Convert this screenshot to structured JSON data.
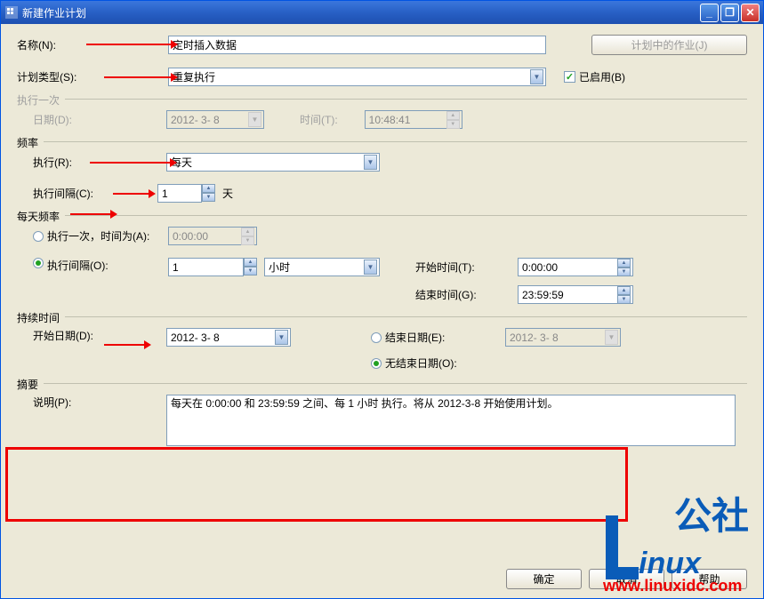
{
  "window": {
    "title": "新建作业计划"
  },
  "form": {
    "name_label": "名称(N):",
    "name_value": "定时插入数据",
    "schedule_type_label": "计划类型(S):",
    "schedule_type_value": "重复执行",
    "active_jobs_button": "计划中的作业(J)",
    "enabled_label": "已启用(B)"
  },
  "once": {
    "legend": "执行一次",
    "date_label": "日期(D):",
    "date_value": "2012- 3- 8",
    "time_label": "时间(T):",
    "time_value": "10:48:41"
  },
  "frequency": {
    "legend": "频率",
    "execute_label": "执行(R):",
    "execute_value": "每天",
    "interval_label": "执行间隔(C):",
    "interval_value": "1",
    "interval_unit": "天"
  },
  "daily": {
    "legend": "每天频率",
    "once_label": "执行一次，时间为(A):",
    "once_time": "0:00:00",
    "interval_label": "执行间隔(O):",
    "interval_value": "1",
    "interval_unit": "小时",
    "start_label": "开始时间(T):",
    "start_value": "0:00:00",
    "end_label": "结束时间(G):",
    "end_value": "23:59:59"
  },
  "duration": {
    "legend": "持续时间",
    "start_date_label": "开始日期(D):",
    "start_date_value": "2012- 3- 8",
    "end_date_label": "结束日期(E):",
    "end_date_value": "2012- 3- 8",
    "no_end_label": "无结束日期(O):"
  },
  "summary": {
    "legend": "摘要",
    "desc_label": "说明(P):",
    "desc_value": "每天在 0:00:00 和 23:59:59 之间、每 1 小时 执行。将从 2012-3-8 开始使用计划。"
  },
  "footer": {
    "ok": "确定",
    "cancel": "取消",
    "help": "帮助"
  },
  "watermark_url": "www.linuxidc.com"
}
